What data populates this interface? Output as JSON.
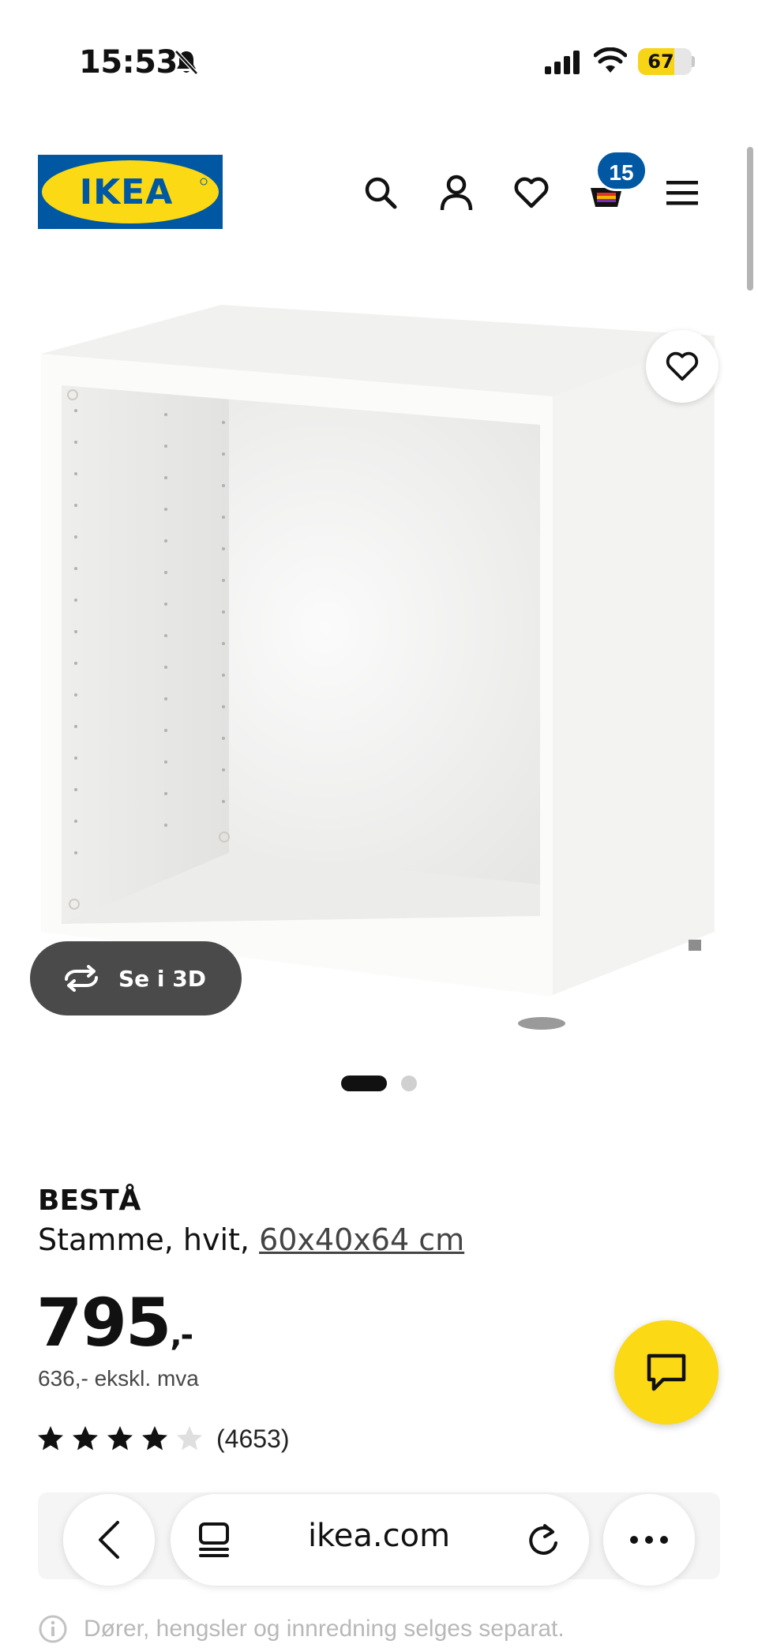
{
  "status_bar": {
    "time": "15:53",
    "battery": "67",
    "battery_level": 0.67
  },
  "header": {
    "logo_text": "IKEA",
    "cart_count": "15"
  },
  "product": {
    "name": "BESTÅ",
    "description": "Stamme, hvit, ",
    "size_link": "60x40x64 cm",
    "price": "795",
    "price_suffix": ",-",
    "price_ex_vat": "636,- ekskl. mva",
    "rating": 4,
    "rating_max": 5,
    "review_count": "(4653)",
    "view_3d_label": "Se i 3D",
    "image_count": 2,
    "active_image": 1
  },
  "browser": {
    "url": "ikea.com"
  },
  "notice": "Dører, hengsler og innredning selges separat.",
  "colors": {
    "brand_blue": "#0058a3",
    "brand_yellow": "#fbd914",
    "battery_yellow": "#f7d416"
  },
  "icons": [
    "bell-slash-icon",
    "signal-icon",
    "wifi-icon",
    "search-icon",
    "user-icon",
    "heart-icon",
    "cart-icon",
    "menu-icon",
    "rotate-3d-icon",
    "chat-icon",
    "back-icon",
    "tabs-icon",
    "reload-icon",
    "more-icon",
    "info-icon"
  ]
}
